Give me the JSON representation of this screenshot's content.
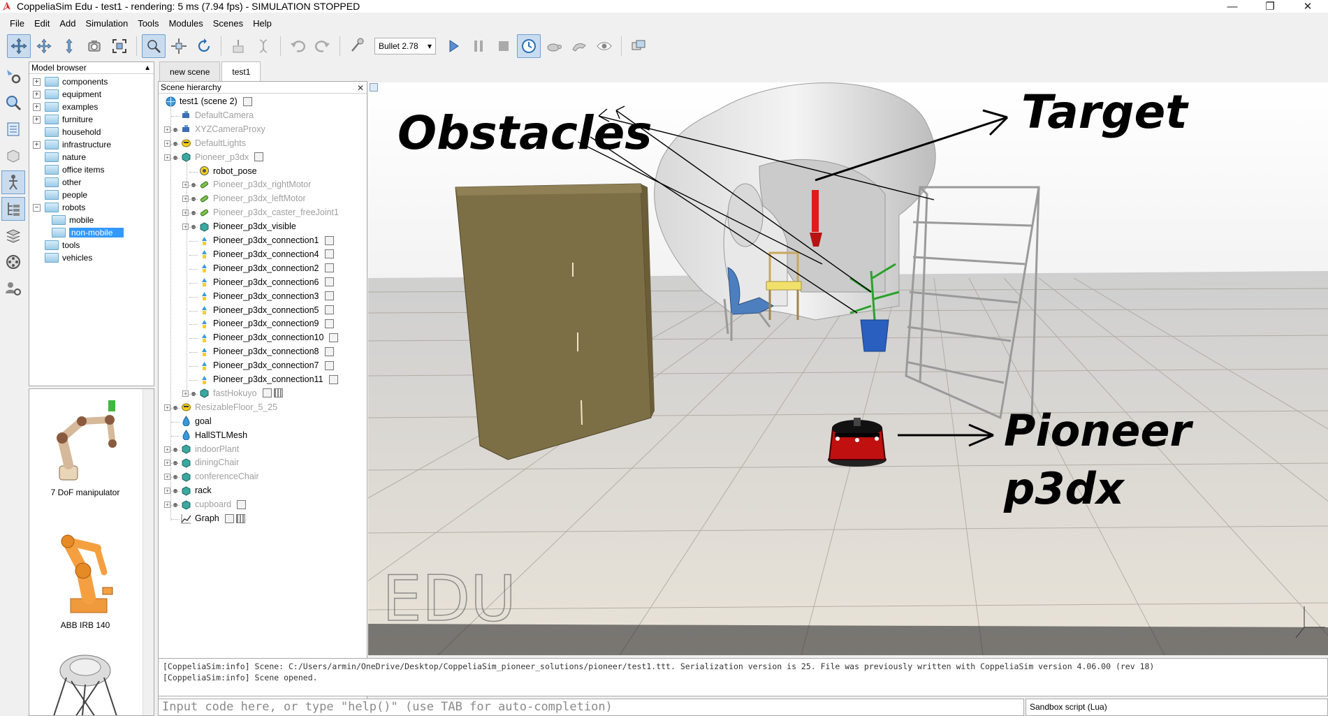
{
  "window": {
    "title": "CoppeliaSim Edu - test1 - rendering: 5 ms (7.94 fps) - SIMULATION STOPPED",
    "minimize": "—",
    "maximize": "❐",
    "close": "✕"
  },
  "menu": [
    "File",
    "Edit",
    "Add",
    "Simulation",
    "Tools",
    "Modules",
    "Scenes",
    "Help"
  ],
  "toolbar": {
    "icons": [
      "camera-pan-icon",
      "camera-rotate-icon",
      "camera-shift-icon",
      "camera-angle-icon",
      "fit-to-view-icon",
      "click-select-icon",
      "object-shift-icon",
      "object-rotate-icon",
      "assemble-icon",
      "transfer-dna-icon",
      "undo-icon",
      "redo-icon",
      "dynamics-icon",
      "start-icon",
      "pause-icon",
      "stop-icon",
      "realtime-icon",
      "slower-icon",
      "faster-icon",
      "visualization-icon",
      "page-selector-icon"
    ],
    "physics_engine": "Bullet 2.78"
  },
  "model_browser": {
    "header": "Model browser",
    "items": [
      {
        "label": "components",
        "expandable": true,
        "expanded": false,
        "indent": 0
      },
      {
        "label": "equipment",
        "expandable": true,
        "expanded": false,
        "indent": 0
      },
      {
        "label": "examples",
        "expandable": true,
        "expanded": false,
        "indent": 0
      },
      {
        "label": "furniture",
        "expandable": true,
        "expanded": false,
        "indent": 0
      },
      {
        "label": "household",
        "expandable": false,
        "expanded": false,
        "indent": 0
      },
      {
        "label": "infrastructure",
        "expandable": true,
        "expanded": false,
        "indent": 0
      },
      {
        "label": "nature",
        "expandable": false,
        "expanded": false,
        "indent": 0
      },
      {
        "label": "office items",
        "expandable": false,
        "expanded": false,
        "indent": 0
      },
      {
        "label": "other",
        "expandable": false,
        "expanded": false,
        "indent": 0
      },
      {
        "label": "people",
        "expandable": false,
        "expanded": false,
        "indent": 0
      },
      {
        "label": "robots",
        "expandable": true,
        "expanded": true,
        "indent": 0
      },
      {
        "label": "mobile",
        "expandable": false,
        "expanded": false,
        "indent": 1
      },
      {
        "label": "non-mobile",
        "expandable": false,
        "expanded": false,
        "indent": 1,
        "selected": true
      },
      {
        "label": "tools",
        "expandable": false,
        "expanded": false,
        "indent": 0
      },
      {
        "label": "vehicles",
        "expandable": false,
        "expanded": false,
        "indent": 0
      }
    ],
    "models": [
      "7 DoF manipulator",
      "ABB IRB 140"
    ]
  },
  "tabs": [
    {
      "label": "new scene",
      "active": false
    },
    {
      "label": "test1",
      "active": true
    }
  ],
  "scene_hierarchy": {
    "header": "Scene hierarchy",
    "close": "✕",
    "rows": [
      {
        "label": "test1 (scene 2)",
        "level": 0,
        "icon": "scene",
        "dim": false,
        "script": true
      },
      {
        "label": "DefaultCamera",
        "level": 1,
        "icon": "camera",
        "dim": true
      },
      {
        "label": "XYZCameraProxy",
        "level": 1,
        "icon": "camera",
        "dim": true,
        "exp": true
      },
      {
        "label": "DefaultLights",
        "level": 1,
        "icon": "light",
        "dim": true,
        "exp": true
      },
      {
        "label": "Pioneer_p3dx",
        "level": 1,
        "icon": "shape",
        "dim": true,
        "exp": true,
        "script": true
      },
      {
        "label": "robot_pose",
        "level": 2,
        "icon": "dummy",
        "dim": false
      },
      {
        "label": "Pioneer_p3dx_rightMotor",
        "level": 2,
        "icon": "joint",
        "dim": true,
        "exp": true
      },
      {
        "label": "Pioneer_p3dx_leftMotor",
        "level": 2,
        "icon": "joint",
        "dim": true,
        "exp": true
      },
      {
        "label": "Pioneer_p3dx_caster_freeJoint1",
        "level": 2,
        "icon": "joint",
        "dim": true,
        "exp": true
      },
      {
        "label": "Pioneer_p3dx_visible",
        "level": 2,
        "icon": "shape",
        "dim": false,
        "exp": true
      },
      {
        "label": "Pioneer_p3dx_connection1",
        "level": 2,
        "icon": "sensor",
        "dim": false,
        "script": true
      },
      {
        "label": "Pioneer_p3dx_connection4",
        "level": 2,
        "icon": "sensor",
        "dim": false,
        "script": true
      },
      {
        "label": "Pioneer_p3dx_connection2",
        "level": 2,
        "icon": "sensor",
        "dim": false,
        "script": true
      },
      {
        "label": "Pioneer_p3dx_connection6",
        "level": 2,
        "icon": "sensor",
        "dim": false,
        "script": true
      },
      {
        "label": "Pioneer_p3dx_connection3",
        "level": 2,
        "icon": "sensor",
        "dim": false,
        "script": true
      },
      {
        "label": "Pioneer_p3dx_connection5",
        "level": 2,
        "icon": "sensor",
        "dim": false,
        "script": true
      },
      {
        "label": "Pioneer_p3dx_connection9",
        "level": 2,
        "icon": "sensor",
        "dim": false,
        "script": true
      },
      {
        "label": "Pioneer_p3dx_connection10",
        "level": 2,
        "icon": "sensor",
        "dim": false,
        "script": true
      },
      {
        "label": "Pioneer_p3dx_connection8",
        "level": 2,
        "icon": "sensor",
        "dim": false,
        "script": true
      },
      {
        "label": "Pioneer_p3dx_connection7",
        "level": 2,
        "icon": "sensor",
        "dim": false,
        "script": true
      },
      {
        "label": "Pioneer_p3dx_connection11",
        "level": 2,
        "icon": "sensor",
        "dim": false,
        "script": true
      },
      {
        "label": "fastHokuyo",
        "level": 2,
        "icon": "shape",
        "dim": true,
        "exp": true,
        "script": true,
        "script2": true
      },
      {
        "label": "ResizableFloor_5_25",
        "level": 1,
        "icon": "light",
        "dim": true,
        "exp": true
      },
      {
        "label": "goal",
        "level": 1,
        "icon": "dummy2",
        "dim": false
      },
      {
        "label": "HallSTLMesh",
        "level": 1,
        "icon": "dummy2",
        "dim": false
      },
      {
        "label": "indoorPlant",
        "level": 1,
        "icon": "shape",
        "dim": true,
        "exp": true
      },
      {
        "label": "diningChair",
        "level": 1,
        "icon": "shape",
        "dim": true,
        "exp": true
      },
      {
        "label": "conferenceChair",
        "level": 1,
        "icon": "shape",
        "dim": true,
        "exp": true
      },
      {
        "label": "rack",
        "level": 1,
        "icon": "shape",
        "dim": false,
        "exp": true
      },
      {
        "label": "cupboard",
        "level": 1,
        "icon": "shape",
        "dim": true,
        "exp": true,
        "script": true
      },
      {
        "label": "Graph",
        "level": 1,
        "icon": "graph",
        "dim": false,
        "script": true,
        "script2": true
      }
    ]
  },
  "viewport": {
    "annotations": {
      "obstacles": "Obstacles",
      "target": "Target",
      "pioneer_line1": "Pioneer",
      "pioneer_line2": "p3dx"
    },
    "watermark": "EDU",
    "colors": {
      "cupboard": "#7d6f45",
      "target_marker": "#e11a1a",
      "robot_body": "#c01010",
      "floor_light": "#e8e2d8",
      "floor_dark": "#cfc8bd"
    }
  },
  "console": {
    "lines": [
      "[CoppeliaSim:info] Scene: C:/Users/armin/OneDrive/Desktop/CoppeliaSim_pioneer_solutions/pioneer/test1.ttt. Serialization version is 25. File was previously written with CoppeliaSim version 4.06.00 (rev 18)",
      "[CoppeliaSim:info] Scene opened."
    ],
    "input_placeholder": "Input code here, or type \"help()\" (use TAB for auto-completion)",
    "script_selector": "Sandbox script (Lua)"
  }
}
